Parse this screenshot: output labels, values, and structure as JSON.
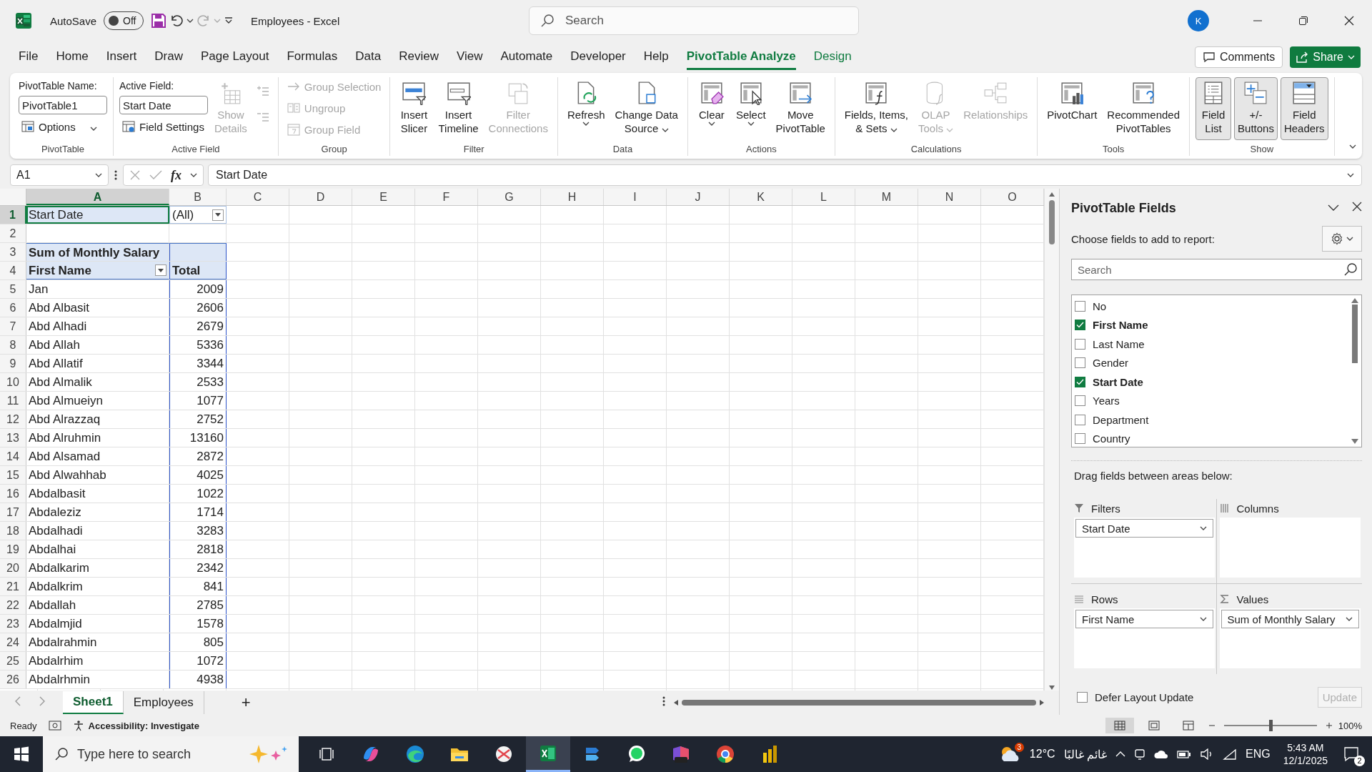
{
  "title_bar": {
    "autosave": {
      "label": "AutoSave",
      "on": false,
      "state_text": "Off"
    },
    "document_title": "Employees - Excel",
    "search": {
      "placeholder": "Search"
    },
    "account_initial": "K"
  },
  "menu_tabs": [
    {
      "label": "File",
      "kind": "standard",
      "selected": false
    },
    {
      "label": "Home",
      "kind": "standard",
      "selected": false
    },
    {
      "label": "Insert",
      "kind": "standard",
      "selected": false
    },
    {
      "label": "Draw",
      "kind": "standard",
      "selected": false
    },
    {
      "label": "Page Layout",
      "kind": "standard",
      "selected": false
    },
    {
      "label": "Formulas",
      "kind": "standard",
      "selected": false
    },
    {
      "label": "Data",
      "kind": "standard",
      "selected": false
    },
    {
      "label": "Review",
      "kind": "standard",
      "selected": false
    },
    {
      "label": "View",
      "kind": "standard",
      "selected": false
    },
    {
      "label": "Automate",
      "kind": "standard",
      "selected": false
    },
    {
      "label": "Developer",
      "kind": "standard",
      "selected": false
    },
    {
      "label": "Help",
      "kind": "standard",
      "selected": false
    },
    {
      "label": "PivotTable Analyze",
      "kind": "contextual",
      "selected": true
    },
    {
      "label": "Design",
      "kind": "contextual",
      "selected": false
    }
  ],
  "comments_button": "Comments",
  "share_button": "Share",
  "ribbon_groups": [
    {
      "label": "PivotTable",
      "columns": [
        [
          {
            "kind": "field",
            "label": "PivotTable Name:",
            "value": "PivotTable1"
          },
          {
            "kind": "small",
            "label": "Options",
            "dropdown": true,
            "disabled": false
          }
        ]
      ]
    },
    {
      "label": "Active Field",
      "columns": [
        [
          {
            "kind": "field",
            "label": "Active Field:",
            "value": "Start Date"
          },
          {
            "kind": "small",
            "label": "Field Settings",
            "dropdown": false,
            "disabled": false
          }
        ],
        [
          {
            "kind": "large",
            "lines": [
              "Show",
              "Details"
            ],
            "disabled": true,
            "dropdown": false,
            "pressed": false
          }
        ],
        [
          {
            "kind": "icon",
            "disabled": true
          },
          {
            "kind": "icon",
            "disabled": true
          }
        ]
      ]
    },
    {
      "label": "Group",
      "columns": [
        [
          {
            "kind": "small",
            "label": "Group Selection",
            "dropdown": false,
            "disabled": true
          },
          {
            "kind": "small",
            "label": "Ungroup",
            "dropdown": false,
            "disabled": true
          },
          {
            "kind": "small",
            "label": "Group Field",
            "dropdown": false,
            "disabled": true
          }
        ]
      ]
    },
    {
      "label": "Filter",
      "columns": [
        [
          {
            "kind": "large",
            "lines": [
              "Insert",
              "Slicer"
            ],
            "disabled": false,
            "dropdown": false,
            "pressed": false
          }
        ],
        [
          {
            "kind": "large",
            "lines": [
              "Insert",
              "Timeline"
            ],
            "disabled": false,
            "dropdown": false,
            "pressed": false
          }
        ],
        [
          {
            "kind": "large",
            "lines": [
              "Filter",
              "Connections"
            ],
            "disabled": true,
            "dropdown": false,
            "pressed": false
          }
        ]
      ]
    },
    {
      "label": "Data",
      "columns": [
        [
          {
            "kind": "large",
            "lines": [
              "Refresh"
            ],
            "disabled": false,
            "dropdown": true,
            "pressed": false
          }
        ],
        [
          {
            "kind": "large",
            "lines": [
              "Change Data",
              "Source"
            ],
            "disabled": false,
            "dropdown": true,
            "pressed": false
          }
        ]
      ]
    },
    {
      "label": "Actions",
      "columns": [
        [
          {
            "kind": "large",
            "lines": [
              "Clear"
            ],
            "disabled": false,
            "dropdown": true,
            "pressed": false
          }
        ],
        [
          {
            "kind": "large",
            "lines": [
              "Select"
            ],
            "disabled": false,
            "dropdown": true,
            "pressed": false
          }
        ],
        [
          {
            "kind": "large",
            "lines": [
              "Move",
              "PivotTable"
            ],
            "disabled": false,
            "dropdown": false,
            "pressed": false
          }
        ]
      ]
    },
    {
      "label": "Calculations",
      "columns": [
        [
          {
            "kind": "large",
            "lines": [
              "Fields, Items,",
              "& Sets"
            ],
            "disabled": false,
            "dropdown": true,
            "pressed": false
          }
        ],
        [
          {
            "kind": "large",
            "lines": [
              "OLAP",
              "Tools"
            ],
            "disabled": true,
            "dropdown": true,
            "pressed": false
          }
        ],
        [
          {
            "kind": "large",
            "lines": [
              "Relationships"
            ],
            "disabled": true,
            "dropdown": false,
            "pressed": false
          }
        ]
      ]
    },
    {
      "label": "Tools",
      "columns": [
        [
          {
            "kind": "large",
            "lines": [
              "PivotChart"
            ],
            "disabled": false,
            "dropdown": false,
            "pressed": false
          }
        ],
        [
          {
            "kind": "large",
            "lines": [
              "Recommended",
              "PivotTables"
            ],
            "disabled": false,
            "dropdown": false,
            "pressed": false
          }
        ]
      ]
    },
    {
      "label": "Show",
      "columns": [
        [
          {
            "kind": "large",
            "lines": [
              "Field",
              "List"
            ],
            "disabled": false,
            "dropdown": false,
            "pressed": true
          }
        ],
        [
          {
            "kind": "large",
            "lines": [
              "+/-",
              "Buttons"
            ],
            "disabled": false,
            "dropdown": false,
            "pressed": true
          }
        ],
        [
          {
            "kind": "large",
            "lines": [
              "Field",
              "Headers"
            ],
            "disabled": false,
            "dropdown": false,
            "pressed": true
          }
        ]
      ]
    }
  ],
  "formula_bar": {
    "name_box": "A1",
    "function_button": "fx",
    "formula": "Start Date"
  },
  "sheet": {
    "columns": [
      {
        "label": "A",
        "selected": true
      },
      {
        "label": "B",
        "selected": false
      },
      {
        "label": "C",
        "selected": false
      },
      {
        "label": "D",
        "selected": false
      },
      {
        "label": "E",
        "selected": false
      },
      {
        "label": "F",
        "selected": false
      },
      {
        "label": "G",
        "selected": false
      },
      {
        "label": "H",
        "selected": false
      },
      {
        "label": "I",
        "selected": false
      },
      {
        "label": "J",
        "selected": false
      },
      {
        "label": "K",
        "selected": false
      },
      {
        "label": "L",
        "selected": false
      },
      {
        "label": "M",
        "selected": false
      },
      {
        "label": "N",
        "selected": false
      },
      {
        "label": "O",
        "selected": false
      }
    ],
    "rows": [
      {
        "number": "1",
        "kind": "page_filter",
        "selected": true,
        "cells": [
          "Start Date",
          "(All)"
        ]
      },
      {
        "number": "2",
        "kind": "blank",
        "selected": false
      },
      {
        "number": "3",
        "kind": "values_header",
        "selected": false,
        "cells": [
          "Sum of Monthly Salary"
        ]
      },
      {
        "number": "4",
        "kind": "row_header",
        "selected": false,
        "cells": [
          "First Name",
          "Total"
        ]
      },
      {
        "number": "5",
        "kind": "data",
        "selected": false,
        "cells": [
          "Jan",
          "2009"
        ]
      },
      {
        "number": "6",
        "kind": "data",
        "selected": false,
        "cells": [
          "Abd Albasit",
          "2606"
        ]
      },
      {
        "number": "7",
        "kind": "data",
        "selected": false,
        "cells": [
          "Abd Alhadi",
          "2679"
        ]
      },
      {
        "number": "8",
        "kind": "data",
        "selected": false,
        "cells": [
          "Abd Allah",
          "5336"
        ]
      },
      {
        "number": "9",
        "kind": "data",
        "selected": false,
        "cells": [
          "Abd Allatif",
          "3344"
        ]
      },
      {
        "number": "10",
        "kind": "data",
        "selected": false,
        "cells": [
          "Abd Almalik",
          "2533"
        ]
      },
      {
        "number": "11",
        "kind": "data",
        "selected": false,
        "cells": [
          "Abd Almueiyn",
          "1077"
        ]
      },
      {
        "number": "12",
        "kind": "data",
        "selected": false,
        "cells": [
          "Abd Alrazzaq",
          "2752"
        ]
      },
      {
        "number": "13",
        "kind": "data",
        "selected": false,
        "cells": [
          "Abd Alruhmin",
          "13160"
        ]
      },
      {
        "number": "14",
        "kind": "data",
        "selected": false,
        "cells": [
          "Abd Alsamad",
          "2872"
        ]
      },
      {
        "number": "15",
        "kind": "data",
        "selected": false,
        "cells": [
          "Abd Alwahhab",
          "4025"
        ]
      },
      {
        "number": "16",
        "kind": "data",
        "selected": false,
        "cells": [
          "Abdalbasit",
          "1022"
        ]
      },
      {
        "number": "17",
        "kind": "data",
        "selected": false,
        "cells": [
          "Abdaleziz",
          "1714"
        ]
      },
      {
        "number": "18",
        "kind": "data",
        "selected": false,
        "cells": [
          "Abdalhadi",
          "3283"
        ]
      },
      {
        "number": "19",
        "kind": "data",
        "selected": false,
        "cells": [
          "Abdalhai",
          "2818"
        ]
      },
      {
        "number": "20",
        "kind": "data",
        "selected": false,
        "cells": [
          "Abdalkarim",
          "2342"
        ]
      },
      {
        "number": "21",
        "kind": "data",
        "selected": false,
        "cells": [
          "Abdalkrim",
          "841"
        ]
      },
      {
        "number": "22",
        "kind": "data",
        "selected": false,
        "cells": [
          "Abdallah",
          "2785"
        ]
      },
      {
        "number": "23",
        "kind": "data",
        "selected": false,
        "cells": [
          "Abdalmjid",
          "1578"
        ]
      },
      {
        "number": "24",
        "kind": "data",
        "selected": false,
        "cells": [
          "Abdalrahmin",
          "805"
        ]
      },
      {
        "number": "25",
        "kind": "data",
        "selected": false,
        "cells": [
          "Abdalrhim",
          "1072"
        ]
      },
      {
        "number": "26",
        "kind": "data",
        "selected": false,
        "cells": [
          "Abdalrhmin",
          "4938"
        ]
      }
    ],
    "sheet_tabs": [
      {
        "label": "Sheet1",
        "selected": true
      },
      {
        "label": "Employees",
        "selected": false
      }
    ],
    "add_sheet": "+"
  },
  "pivot_fields_pane": {
    "title": "PivotTable Fields",
    "instruction": "Choose fields to add to report:",
    "search": {
      "placeholder": "Search"
    },
    "fields": [
      {
        "label": "No",
        "checked": false
      },
      {
        "label": "First Name",
        "checked": true
      },
      {
        "label": "Last Name",
        "checked": false
      },
      {
        "label": "Gender",
        "checked": false
      },
      {
        "label": "Start Date",
        "checked": true
      },
      {
        "label": "Years",
        "checked": false
      },
      {
        "label": "Department",
        "checked": false
      },
      {
        "label": "Country",
        "checked": false
      }
    ],
    "areas_instruction": "Drag fields between areas below:",
    "areas": [
      {
        "kind": "filters",
        "label": "Filters",
        "items": [
          "Start Date"
        ]
      },
      {
        "kind": "columns",
        "label": "Columns"
      },
      {
        "kind": "rows",
        "label": "Rows",
        "items": [
          "First Name"
        ]
      },
      {
        "kind": "values",
        "label": "Values",
        "items": [
          "Sum of Monthly Salary"
        ]
      }
    ],
    "defer_update": {
      "label": "Defer Layout Update",
      "checked": false
    },
    "update_button": {
      "label": "Update",
      "disabled": true
    }
  },
  "status_bar": {
    "mode": "Ready",
    "accessibility": "Accessibility: Investigate",
    "views": [
      {
        "kind": "normal",
        "selected": true
      },
      {
        "kind": "page_layout",
        "selected": false
      },
      {
        "kind": "page_break",
        "selected": false
      }
    ],
    "zoom": {
      "level": 0.5,
      "reading": "100%"
    }
  },
  "taskbar": {
    "search": {
      "placeholder": "Type here to search"
    },
    "apps": [
      {
        "kind": "task_view",
        "selected": false
      },
      {
        "kind": "copilot",
        "selected": false
      },
      {
        "kind": "edge",
        "selected": false
      },
      {
        "kind": "explorer",
        "selected": false
      },
      {
        "kind": "snip",
        "selected": false
      },
      {
        "kind": "excel",
        "selected": true
      },
      {
        "kind": "mail",
        "selected": false
      },
      {
        "kind": "whatsapp",
        "selected": false
      },
      {
        "kind": "m365",
        "selected": false
      },
      {
        "kind": "chrome",
        "selected": false
      },
      {
        "kind": "powerbi",
        "selected": false
      }
    ],
    "weather": {
      "badge": "3",
      "temperature": "12°C",
      "condition": "غائم غالبًا"
    },
    "language": "ENG",
    "time": "5:43 AM",
    "date": "12/1/2025",
    "notifications_badge": "2"
  }
}
